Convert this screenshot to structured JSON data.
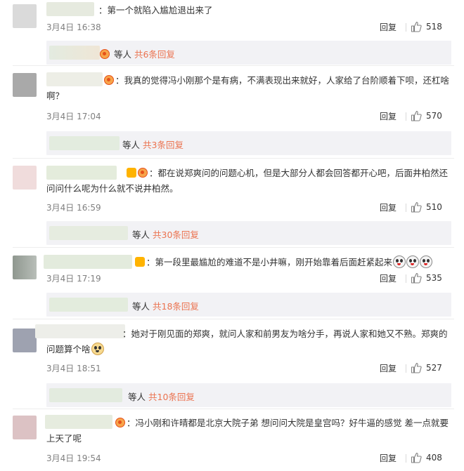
{
  "reply_label": "回复",
  "sub_prefix": "等人",
  "comments": [
    {
      "text": "：第一个就陷入尴尬退出来了",
      "time": "3月4日 16:38",
      "likes": "518",
      "sub_replies": "共6条回复",
      "avatar_color": "#d8d8d8"
    },
    {
      "text": "：我真的觉得冯小刚那个是有病，不满表现出来就好，人家给了台阶顺着下呗，还杠啥啊？",
      "time": "3月4日 17:04",
      "likes": "570",
      "sub_replies": "共3条回复",
      "avatar_color": "#a9a9a9"
    },
    {
      "text": "：都在说郑爽问的问题心机，但是大部分人都会回答都开心吧，后面井柏然还问问什么呢为什么就不说井柏然。",
      "time": "3月4日 16:59",
      "likes": "510",
      "sub_replies": "共30条回复",
      "avatar_color": "#f0dcdc"
    },
    {
      "text": "：第一段里最尴尬的难道不是小井嘛，刚开始靠着后面赶紧起来",
      "time": "3月4日 17:19",
      "likes": "535",
      "sub_replies": "共18条回复",
      "avatar_color": "#9aa19a"
    },
    {
      "text": "：她对于刚见面的郑爽，就问人家和前男友为啥分手，再说人家和她又不熟。郑爽的问题算个啥",
      "time": "3月4日 18:51",
      "likes": "527",
      "sub_replies": "共10条回复",
      "avatar_color": "#9ea2b0"
    },
    {
      "text": "：冯小刚和许晴都是北京大院子弟 想问问大院是皇宫吗？好牛逼的感觉   差一点就要上天了呢",
      "time": "3月4日 19:54",
      "likes": "408",
      "avatar_color": "#dcc2c4"
    }
  ],
  "colors": {
    "accent": "#eb7350",
    "sub_bg": "#f2f2f5",
    "meta": "#808080"
  }
}
